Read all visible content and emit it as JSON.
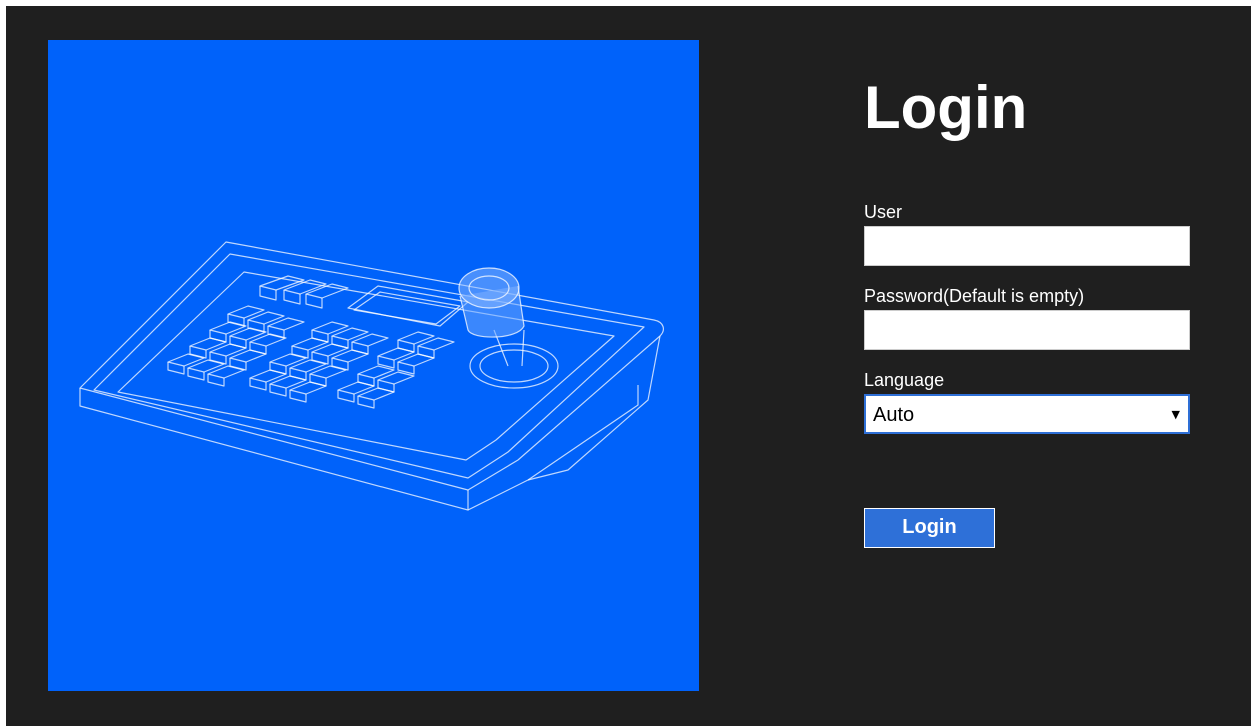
{
  "login": {
    "title": "Login",
    "user_label": "User",
    "user_value": "",
    "password_label": "Password(Default is empty)",
    "password_value": "",
    "language_label": "Language",
    "language_selected": "Auto",
    "dropdown_arrow": "▼",
    "button_label": "Login"
  },
  "illustration": {
    "icon": "ptz-keyboard-controller-icon",
    "background_color": "#0062fa"
  },
  "colors": {
    "page_background": "#1f1f1f",
    "accent": "#2e70d8",
    "text": "#ffffff"
  }
}
